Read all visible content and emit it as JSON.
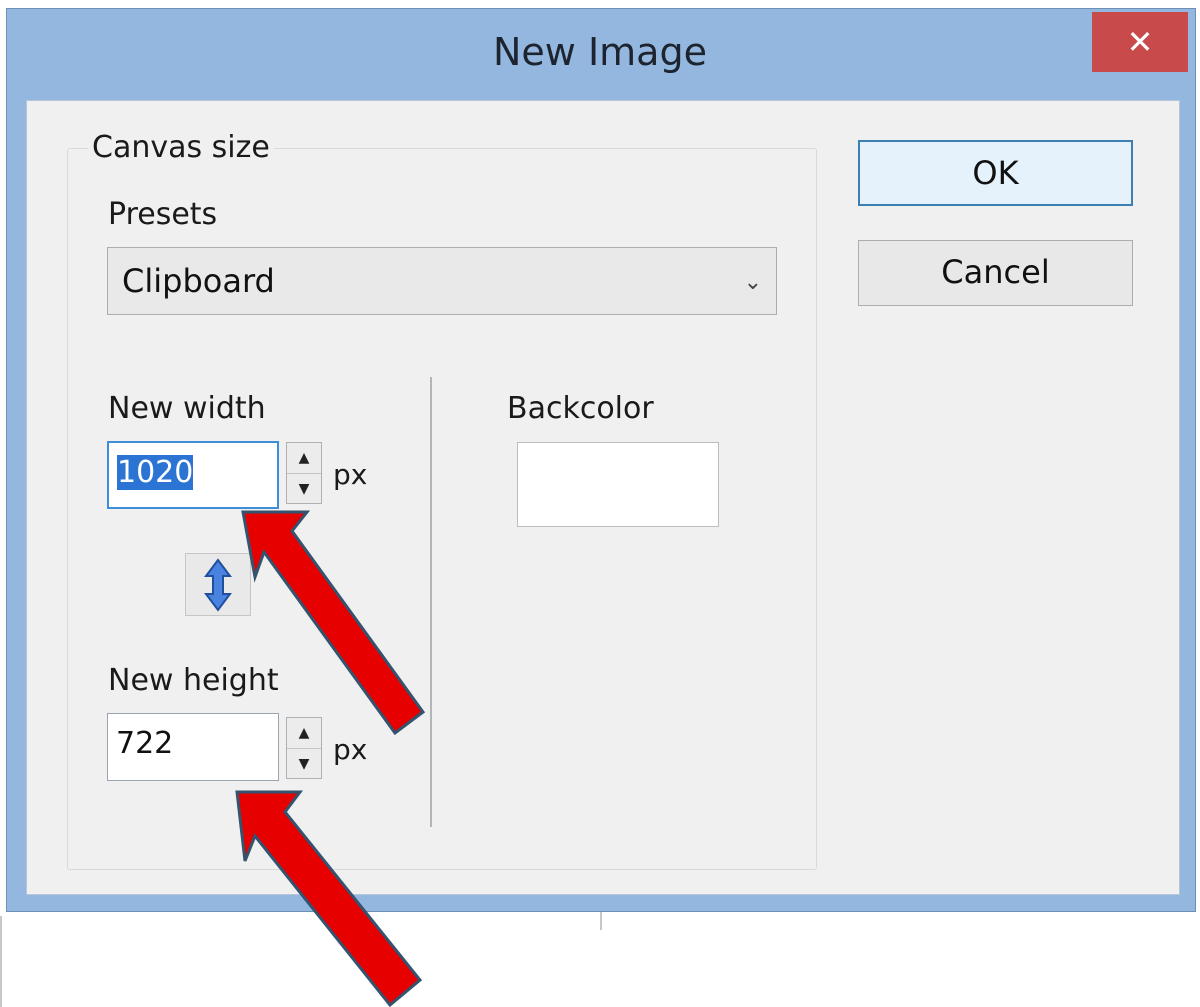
{
  "window": {
    "title": "New Image",
    "close_glyph": "✕"
  },
  "canvas_group": {
    "legend": "Canvas size",
    "presets_label": "Presets",
    "presets_value": "Clipboard",
    "width_label": "New width",
    "width_value": "1020",
    "height_label": "New height",
    "height_value": "722",
    "unit": "px",
    "backcolor_label": "Backcolor",
    "backcolor_value": "#ffffff"
  },
  "buttons": {
    "ok": "OK",
    "cancel": "Cancel"
  },
  "annotations": {
    "arrow_color": "#e60000",
    "arrow_stroke": "#33536e"
  }
}
